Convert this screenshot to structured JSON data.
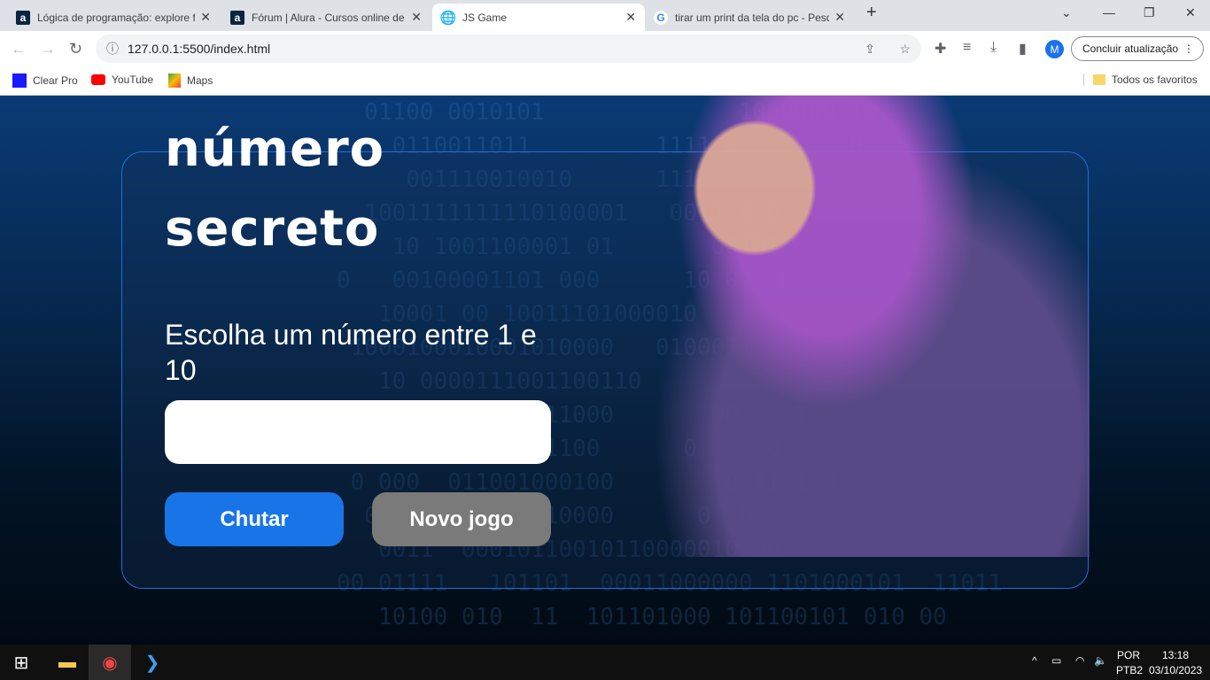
{
  "browser": {
    "tabs": [
      {
        "title": "Lógica de programação: explore f",
        "favicon": "alura-icon"
      },
      {
        "title": "Fórum | Alura - Cursos online de",
        "favicon": "alura-icon"
      },
      {
        "title": "JS Game",
        "favicon": "globe-icon",
        "active": true
      },
      {
        "title": "tirar um print da tela do pc - Pesq",
        "favicon": "google-icon"
      }
    ],
    "url": "127.0.0.1:5500/index.html",
    "update_label": "Concluir atualização",
    "profile_initial": "M",
    "bookmarks": [
      {
        "label": "Clear Pro"
      },
      {
        "label": "YouTube"
      },
      {
        "label": "Maps"
      }
    ],
    "all_bookmarks": "Todos os favoritos"
  },
  "game": {
    "title_line1": "número",
    "title_line2": "secreto",
    "prompt": "Escolha um número entre 1 e 10",
    "input_value": "",
    "guess_button": "Chutar",
    "new_game_button": "Novo jogo",
    "colors": {
      "accent": "#1875e8",
      "disabled": "#7a7a7a",
      "border": "#1e6fd9"
    }
  },
  "taskbar": {
    "lang": "POR",
    "layout": "PTB2",
    "time": "13:18",
    "date": "03/10/2023"
  }
}
